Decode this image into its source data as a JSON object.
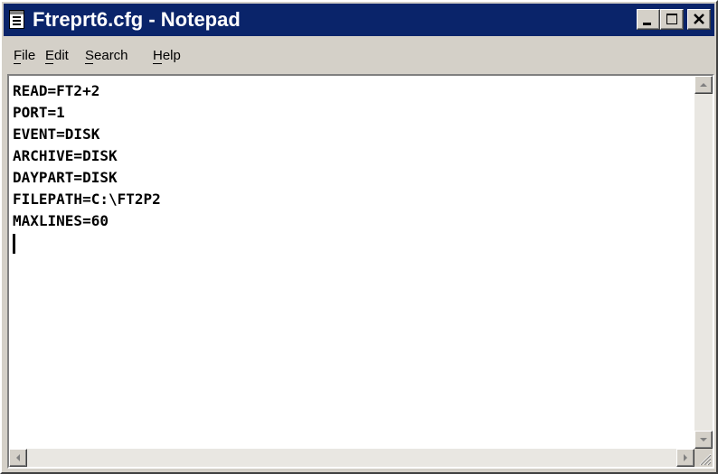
{
  "window": {
    "title": "Ftreprt6.cfg - Notepad",
    "titlebar_color": "#0a246a",
    "chrome_color": "#d4d0c8"
  },
  "menu": {
    "items": [
      {
        "label": "File",
        "accel": "F"
      },
      {
        "label": "Edit",
        "accel": "E"
      },
      {
        "label": "Search",
        "accel": "S"
      },
      {
        "label": "Help",
        "accel": "H"
      }
    ]
  },
  "editor": {
    "lines": [
      "READ=FT2+2",
      "PORT=1",
      "EVENT=DISK",
      "ARCHIVE=DISK",
      "DAYPART=DISK",
      "FILEPATH=C:\\FT2P2",
      "MAXLINES=60"
    ]
  },
  "icons": {
    "app": "notepad-icon",
    "minimize": "minimize-icon",
    "maximize": "maximize-icon",
    "close": "close-icon",
    "scroll_up": "arrow-up-icon",
    "scroll_down": "arrow-down-icon",
    "scroll_left": "arrow-left-icon",
    "scroll_right": "arrow-right-icon",
    "resize": "resize-grip-icon"
  }
}
